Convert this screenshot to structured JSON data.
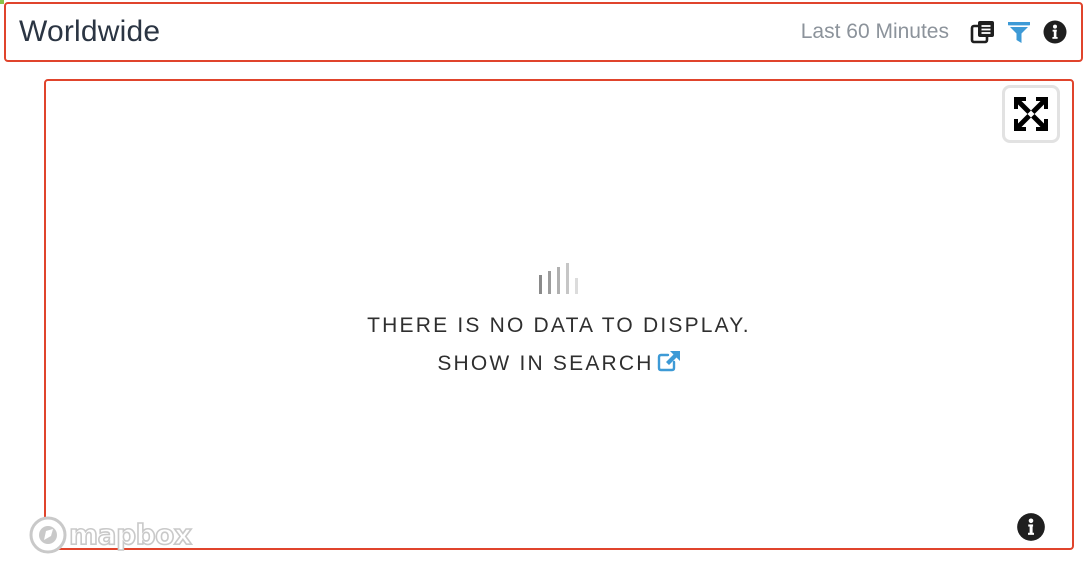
{
  "header": {
    "title": "Worldwide",
    "timeframe": "Last 60 Minutes",
    "icons": [
      "copy-icon",
      "filter-icon",
      "info-icon"
    ]
  },
  "map": {
    "empty_message": "THERE IS NO DATA TO DISPLAY.",
    "search_link": "SHOW IN SEARCH",
    "attribution_logo": "mapbox",
    "icons": [
      "expand-icon",
      "bar-chart-icon",
      "external-link-icon",
      "info-icon"
    ]
  },
  "colors": {
    "highlight_border": "#e0442c",
    "filter_icon": "#3d9ad6",
    "link_icon": "#3d9ad6",
    "title_text": "#2b3543",
    "muted_text": "#8c939b"
  }
}
